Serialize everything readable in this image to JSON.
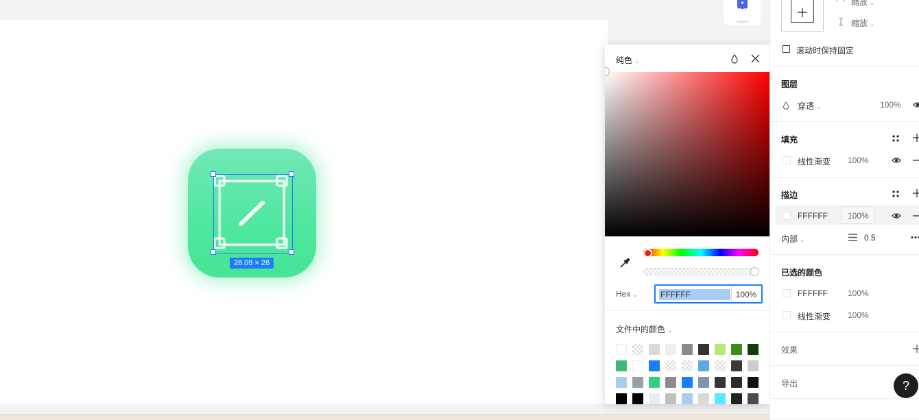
{
  "canvas": {
    "selection_size": "28.09 × 28"
  },
  "color_picker": {
    "fill_type": "纯色",
    "format": "Hex",
    "hex_value": "FFFFFF",
    "opacity": "100%",
    "doc_colors_title": "文件中的颜色",
    "hue": 0,
    "saturation": 0,
    "brightness": 1,
    "alpha": 1,
    "swatches": [
      [
        "#ffffff",
        "checker",
        "#d9d9d9",
        "#f0f0f3",
        "#8a8a8a",
        "#333333",
        "#b3ec6f",
        "#3a8d16",
        "#0f3d0a"
      ],
      [
        "#3dbb74",
        "#ffffff",
        "#1a7cff",
        "checker",
        "checker",
        "#5ea9de",
        "checker",
        "#3a3a3a",
        "#cccccc"
      ],
      [
        "#a9cdef",
        "#9aa0a6",
        "#33d17a",
        "#8c8c8c",
        "#1a7cff",
        "#7f93ad",
        "#333333",
        "#2a2a2a",
        "#111111"
      ],
      [
        "#000000",
        "#000000",
        "#e8ecf5",
        "#bfbfbf",
        "#a9cdef",
        "#d9d9d9",
        "#5ce7ff",
        "#222222",
        "#4a4a4a"
      ]
    ]
  },
  "right_panel": {
    "constraint_h": "缩放",
    "constraint_v": "缩放",
    "fix_on_scroll": "滚动时保持固定",
    "layer_title": "图层",
    "layer_blend": "穿透",
    "layer_opacity": "100%",
    "fill_title": "填充",
    "fill_name": "线性渐变",
    "fill_opacity": "100%",
    "stroke_title": "描边",
    "stroke_hex": "FFFFFF",
    "stroke_opacity": "100%",
    "stroke_position": "内部",
    "stroke_weight": "0.5",
    "selected_colors_title": "已选的颜色",
    "selected_colors": [
      {
        "label": "FFFFFF",
        "opacity": "100%"
      },
      {
        "label": "线性渐变",
        "opacity": "100%"
      }
    ],
    "effects_title": "效果",
    "export_title": "导出",
    "help_label": "?"
  }
}
